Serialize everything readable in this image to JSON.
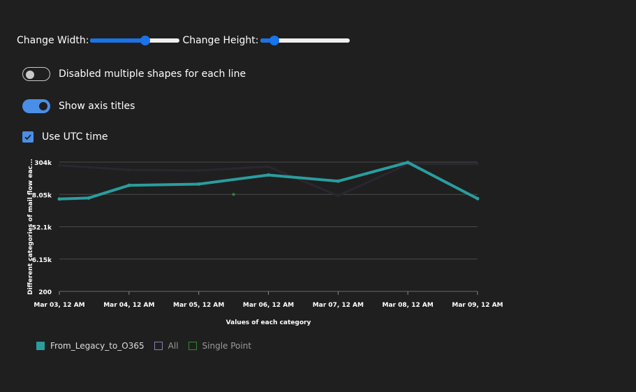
{
  "controls": {
    "width_label": "Change Width:",
    "width_value": 0.61,
    "height_label": "Change Height:",
    "height_value": 0.16,
    "shapes_toggle_label": "Disabled multiple shapes for each line",
    "shapes_toggle_on": false,
    "axis_titles_label": "Show axis titles",
    "axis_titles_on": true,
    "utc_label": "Use UTC time",
    "utc_checked": true
  },
  "chart_data": {
    "type": "line",
    "xlabel": "Values of each category",
    "ylabel": "Different categories of mail flow eac...",
    "y_ticks": [
      "304k",
      "8.05k",
      "52.1k",
      "6.15k",
      "200"
    ],
    "x_ticks": [
      "Mar 03, 12 AM",
      "Mar 04, 12 AM",
      "Mar 05, 12 AM",
      "Mar 06, 12 AM",
      "Mar 07, 12 AM",
      "Mar 08, 12 AM",
      "Mar 09, 12 AM"
    ],
    "x_range": [
      0,
      6
    ],
    "y_range": [
      0,
      4
    ],
    "series": [
      {
        "name": "From_Legacy_to_O365",
        "color": "#2a9d9f",
        "points": [
          [
            0,
            2.86
          ],
          [
            0.42,
            2.89
          ],
          [
            1,
            3.28
          ],
          [
            2,
            3.32
          ],
          [
            3,
            3.6
          ],
          [
            4,
            3.41
          ],
          [
            5,
            3.99
          ],
          [
            6,
            2.87
          ]
        ]
      },
      {
        "name": "All",
        "color": "#2b2631",
        "points": [
          [
            0,
            3.9
          ],
          [
            1,
            3.76
          ],
          [
            2,
            3.74
          ],
          [
            3,
            3.86
          ],
          [
            4,
            2.96
          ],
          [
            5,
            3.94
          ],
          [
            6,
            3.94
          ]
        ]
      },
      {
        "name": "Single Point",
        "color": "#2e8b2e",
        "points": [
          [
            2.5,
            3.0
          ]
        ]
      }
    ],
    "legend_position": "bottom-left",
    "grid": true
  }
}
